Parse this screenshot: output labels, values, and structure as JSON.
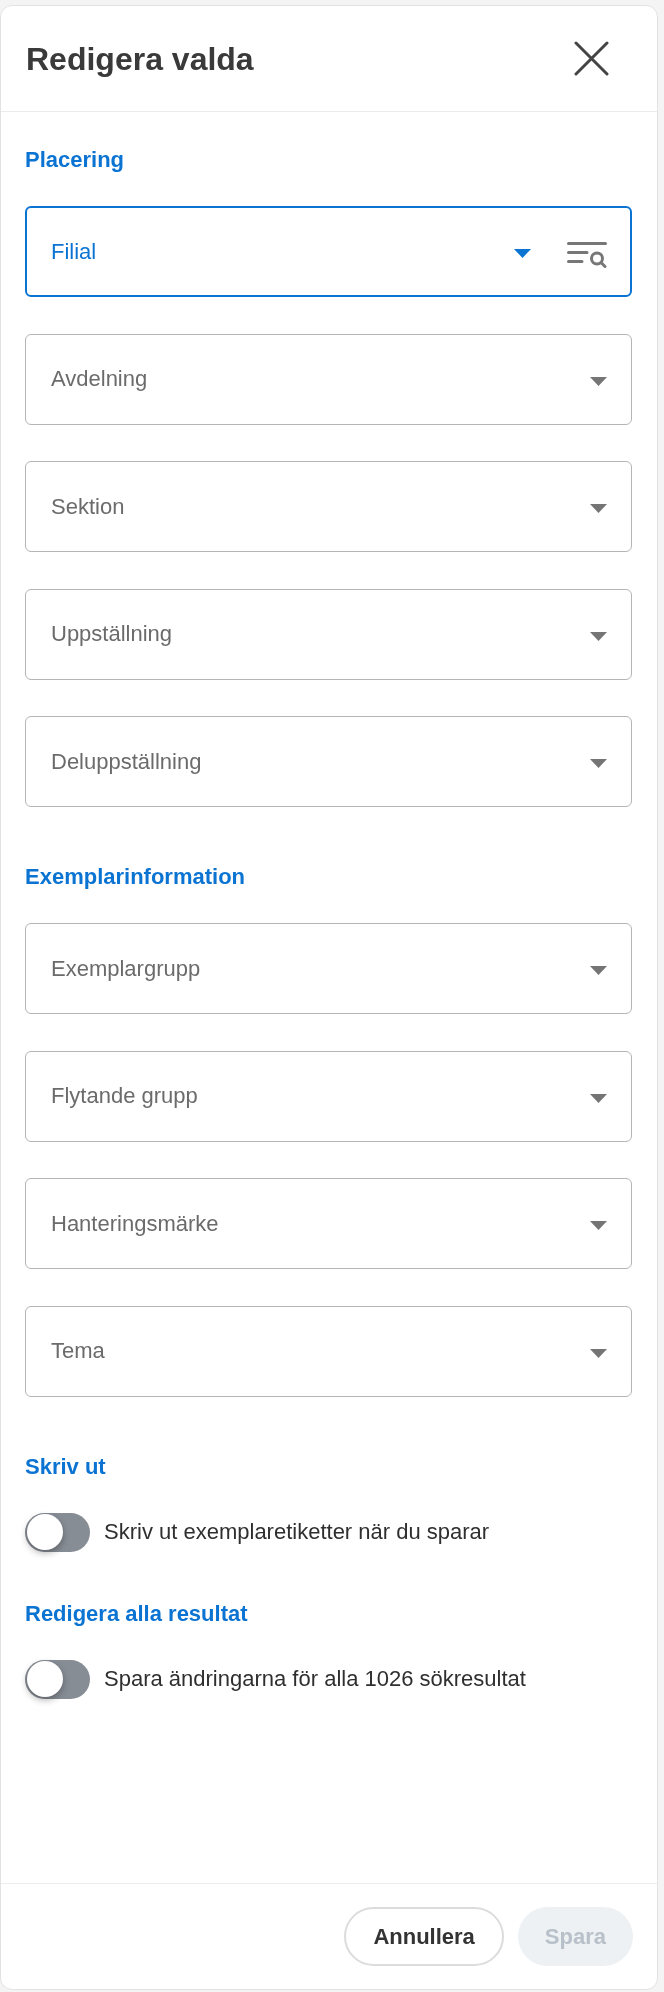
{
  "dialog": {
    "title": "Redigera valda"
  },
  "sections": [
    {
      "heading": "Placering",
      "kind": "fields",
      "items": [
        {
          "kind": "select_search",
          "label": "Filial",
          "focused": true
        },
        {
          "kind": "select",
          "label": "Avdelning",
          "focused": false
        },
        {
          "kind": "select",
          "label": "Sektion",
          "focused": false
        },
        {
          "kind": "select",
          "label": "Uppställning",
          "focused": false
        },
        {
          "kind": "select",
          "label": "Deluppställning",
          "focused": false
        }
      ]
    },
    {
      "heading": "Exemplarinformation",
      "kind": "fields",
      "items": [
        {
          "kind": "select",
          "label": "Exemplargrupp",
          "focused": false
        },
        {
          "kind": "select",
          "label": "Flytande grupp",
          "focused": false
        },
        {
          "kind": "select",
          "label": "Hanteringsmärke",
          "focused": false
        },
        {
          "kind": "select",
          "label": "Tema",
          "focused": false
        }
      ]
    },
    {
      "heading": "Skriv ut",
      "kind": "toggles",
      "items": [
        {
          "kind": "toggle",
          "label": "Skriv ut exemplaretiketter när du sparar",
          "on": false
        }
      ]
    },
    {
      "heading": "Redigera alla resultat",
      "kind": "toggles",
      "items": [
        {
          "kind": "toggle",
          "label": "Spara ändringarna för alla 1026 sökresultat",
          "on": false
        }
      ]
    }
  ],
  "footer": {
    "buttons": [
      {
        "kind": "outline",
        "label": "Annullera",
        "disabled": false
      },
      {
        "kind": "filled",
        "label": "Spara",
        "disabled": true
      }
    ]
  }
}
